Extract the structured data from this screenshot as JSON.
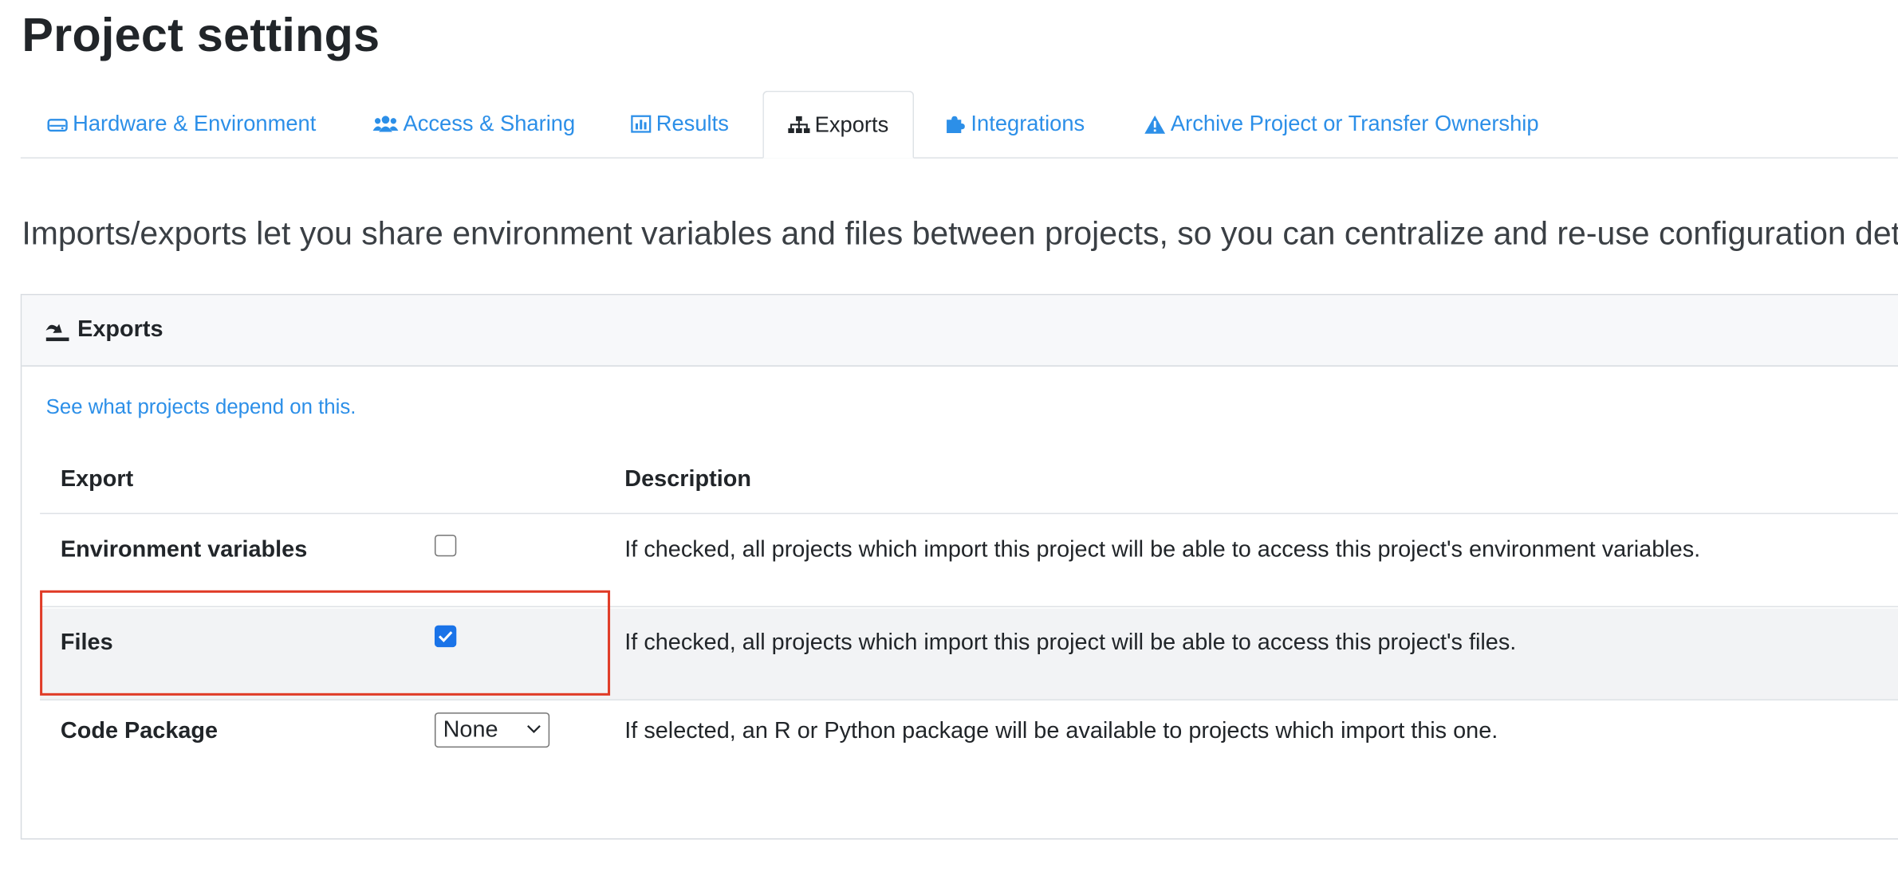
{
  "page": {
    "title": "Project settings",
    "intro": "Imports/exports let you share environment variables and files between projects, so you can centralize and re-use configuration deta"
  },
  "tabs": [
    {
      "label": "Hardware & Environment",
      "icon": "hard-drive-icon",
      "active": false
    },
    {
      "label": "Access & Sharing",
      "icon": "users-icon",
      "active": false
    },
    {
      "label": "Results",
      "icon": "bar-chart-icon",
      "active": false
    },
    {
      "label": "Exports",
      "icon": "sitemap-icon",
      "active": true
    },
    {
      "label": "Integrations",
      "icon": "puzzle-piece-icon",
      "active": false
    },
    {
      "label": "Archive Project or Transfer Ownership",
      "icon": "warning-icon",
      "active": false
    }
  ],
  "card": {
    "title": "Exports",
    "icon": "export-icon",
    "link": "See what projects depend on this."
  },
  "table": {
    "headers": {
      "export": "Export",
      "description": "Description"
    },
    "rows": [
      {
        "name": "Environment variables",
        "control": "checkbox",
        "checked": false,
        "description": "If checked, all projects which import this project will be able to access this project's environment variables."
      },
      {
        "name": "Files",
        "control": "checkbox",
        "checked": true,
        "description": "If checked, all projects which import this project will be able to access this project's files."
      },
      {
        "name": "Code Package",
        "control": "select",
        "selected": "None",
        "description": "If selected, an R or Python package will be available to projects which import this one."
      }
    ]
  },
  "colors": {
    "link": "#2c8fe8",
    "checkbox_checked": "#1a73e8",
    "highlight": "#e03b27"
  }
}
